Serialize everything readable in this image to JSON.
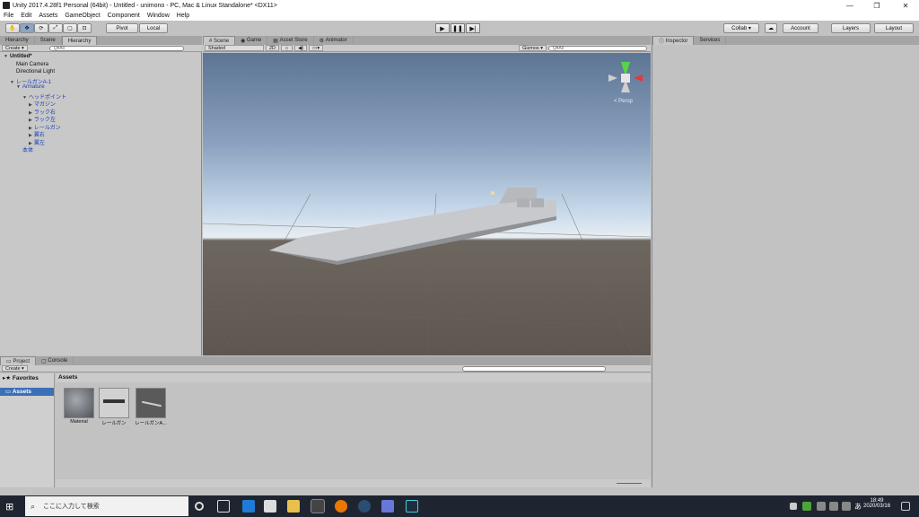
{
  "window": {
    "title": "Unity 2017.4.28f1 Personal (64bit) - Untitled - unimono - PC, Mac & Linux Standalone* <DX11>",
    "controls": {
      "minimize": "—",
      "maximize": "❐",
      "close": "✕"
    }
  },
  "menu": [
    "File",
    "Edit",
    "Assets",
    "GameObject",
    "Component",
    "Window",
    "Help"
  ],
  "toolbar": {
    "pivot_label": "Pivot",
    "local_label": "Local",
    "collab_label": "Collab ▾",
    "account_label": "Account",
    "layers_label": "Layers",
    "layout_label": "Layout"
  },
  "hierarchy": {
    "tabs": [
      "Hierarchy",
      "Scene",
      "Hierarchy"
    ],
    "create_label": "Create ▾",
    "search_placeholder": "Q▾All",
    "items": [
      {
        "label": "Untitled*",
        "depth": 0,
        "expanded": true
      },
      {
        "label": "Main Camera",
        "depth": 1
      },
      {
        "label": "Directional Light",
        "depth": 1
      },
      {
        "label": "レールガンA-1",
        "depth": 1,
        "expanded": true
      },
      {
        "label": "Armature",
        "depth": 2,
        "expanded": true
      },
      {
        "label": "ヘッドポイント",
        "depth": 3,
        "expanded": true
      },
      {
        "label": "マガジン",
        "depth": 4,
        "collapsed": true
      },
      {
        "label": "ラック右",
        "depth": 4,
        "collapsed": true
      },
      {
        "label": "ラック左",
        "depth": 4,
        "collapsed": true
      },
      {
        "label": "レールガン",
        "depth": 4,
        "collapsed": true
      },
      {
        "label": "翼右",
        "depth": 4,
        "collapsed": true
      },
      {
        "label": "翼左",
        "depth": 4,
        "collapsed": true
      },
      {
        "label": "本体",
        "depth": 2
      }
    ]
  },
  "scene": {
    "tabs": [
      "Scene",
      "Game",
      "Asset Store",
      "Animator"
    ],
    "shading_label": "Shaded",
    "mode_2d": "2D",
    "gizmos_label": "Gizmos ▾",
    "search_placeholder": "Q▾All",
    "persp_label": "< Persp"
  },
  "inspector": {
    "tabs": [
      "Inspector",
      "Services"
    ]
  },
  "project": {
    "tabs": [
      "Project",
      "Console"
    ],
    "create_label": "Create ▾",
    "favorites_label": "Favorites",
    "assets_root_label": "Assets",
    "breadcrumb": "Assets",
    "assets": [
      {
        "label": "Material"
      },
      {
        "label": "レールガン"
      },
      {
        "label": "レールガンA..."
      }
    ]
  },
  "taskbar": {
    "search_placeholder": "ここに入力して検索",
    "time": "18:49",
    "date": "2020/03/16",
    "lang": "あ"
  }
}
